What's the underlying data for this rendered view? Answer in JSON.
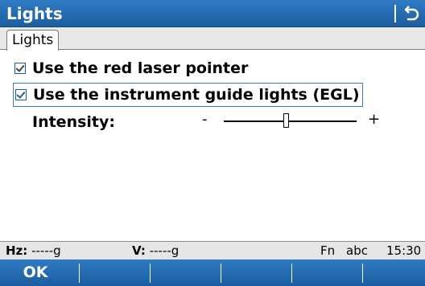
{
  "window": {
    "title": "Lights"
  },
  "icons": {
    "back": "back-arrow-icon"
  },
  "tabs": [
    {
      "label": "Lights",
      "selected": true
    }
  ],
  "options": [
    {
      "label": "Use the red laser pointer",
      "checked": true
    },
    {
      "label": "Use the instrument guide lights (EGL)",
      "checked": true,
      "focused": true
    }
  ],
  "intensity": {
    "label": "Intensity:",
    "min_symbol": "-",
    "max_symbol": "+",
    "level_fraction": 0.47
  },
  "status": {
    "hz_label": "Hz:",
    "hz_value": "-----g",
    "v_label": "V:",
    "v_value": "-----g",
    "fn": "Fn",
    "input_mode": "abc",
    "time": "15:30"
  },
  "softkeys": [
    "OK",
    "",
    "",
    "",
    "",
    ""
  ],
  "colors": {
    "accent": "#1c5d9f",
    "status_bg": "#e6e6e6"
  }
}
